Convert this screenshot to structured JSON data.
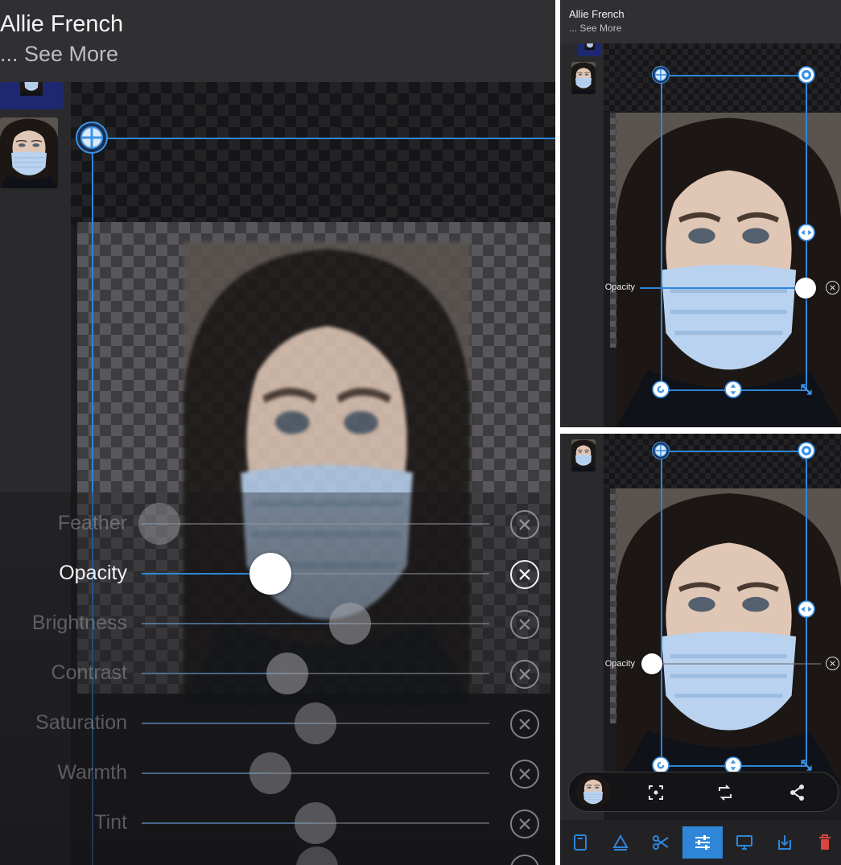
{
  "header": {
    "title": "Allie French",
    "see_more": "... See More"
  },
  "adjustments": [
    {
      "key": "feather",
      "label": "Feather",
      "value": 0.05,
      "active": false
    },
    {
      "key": "opacity",
      "label": "Opacity",
      "value": 0.37,
      "active": true
    },
    {
      "key": "brightness",
      "label": "Brightness",
      "value": 0.6,
      "active": false
    },
    {
      "key": "contrast",
      "label": "Contrast",
      "value": 0.42,
      "active": false
    },
    {
      "key": "saturation",
      "label": "Saturation",
      "value": 0.5,
      "active": false
    },
    {
      "key": "warmth",
      "label": "Warmth",
      "value": 0.37,
      "active": false
    },
    {
      "key": "tint",
      "label": "Tint",
      "value": 0.5,
      "active": false
    }
  ],
  "top_right": {
    "opacity_label": "Opacity",
    "opacity_value": 0.98
  },
  "bottom_right": {
    "opacity_label": "Opacity",
    "opacity_value": 0.0,
    "toolbar": {
      "selected_index": 3,
      "items": [
        "layers-icon",
        "erase-icon",
        "cut-icon",
        "adjust-icon",
        "display-icon",
        "export-icon",
        "delete-icon"
      ]
    }
  },
  "colors": {
    "accent": "#2f86d8",
    "delete": "#d9453f",
    "background": "#1d1d1f",
    "header": "#303033"
  }
}
